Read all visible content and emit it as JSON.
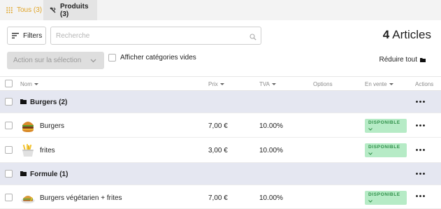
{
  "tabs": [
    {
      "label": "Tous (3)",
      "icon": "grid-icon",
      "color": "#e0a426"
    },
    {
      "label": "Produits (3)",
      "icon": "utensils-icon"
    }
  ],
  "toolbar": {
    "filters_label": "Filters",
    "search_placeholder": "Recherche",
    "search_value": "",
    "article_count": "4",
    "article_label": "Articles",
    "bulk_action_label": "Action sur la sélection",
    "show_empty_label": "Afficher catégories vides",
    "show_empty_checked": false,
    "collapse_label": "Réduire tout"
  },
  "table": {
    "headers": {
      "name": "Nom",
      "price": "Prix",
      "tva": "TVA",
      "options": "Options",
      "on_sale": "En vente",
      "actions": "Actions"
    },
    "categories": [
      {
        "label": "Burgers (2)",
        "items": [
          {
            "name": "Burgers",
            "price": "7,00 €",
            "tva": "10.00%",
            "status": "DISPONIBLE",
            "thumb": "burger"
          },
          {
            "name": "frites",
            "price": "3,00 €",
            "tva": "10.00%",
            "status": "DISPONIBLE",
            "thumb": "fries"
          }
        ]
      },
      {
        "label": "Formule (1)",
        "items": [
          {
            "name": "Burgers végétarien + frites",
            "price": "7,00 €",
            "tva": "10.00%",
            "status": "DISPONIBLE",
            "thumb": "veggie-burger"
          }
        ]
      }
    ]
  },
  "colors": {
    "accent": "#e0a426",
    "category_row": "#e5e7f1",
    "badge_bg": "#b6ebc6",
    "badge_text": "#2e8f48"
  }
}
